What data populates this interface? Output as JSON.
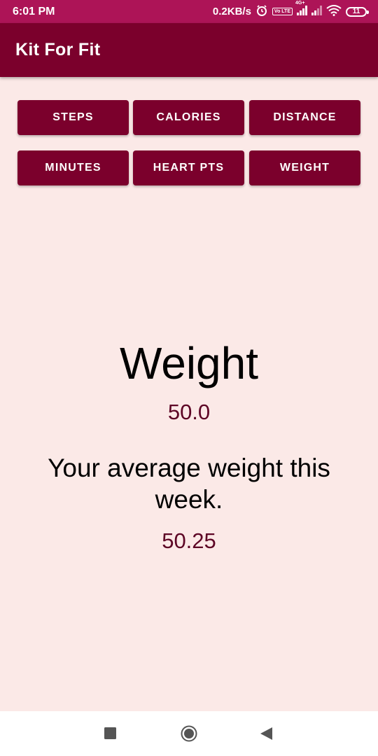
{
  "status_bar": {
    "time": "6:01 PM",
    "net_speed": "0.2KB/s",
    "volte_label": "Vo LTE",
    "network_label": "4G+",
    "battery": "11",
    "icons": [
      "alarm-icon",
      "signal-icon",
      "wifi-icon",
      "battery-icon"
    ]
  },
  "app_bar": {
    "title": "Kit For Fit"
  },
  "buttons": {
    "row1": [
      "STEPS",
      "CALORIES",
      "DISTANCE"
    ],
    "row2": [
      "MINUTES",
      "HEART PTS",
      "WEIGHT"
    ]
  },
  "metric": {
    "title": "Weight",
    "value": "50.0",
    "average_label": "Your average weight this week.",
    "average_value": "50.25"
  },
  "nav_bar": {
    "icons": [
      "recents-icon",
      "home-icon",
      "back-icon"
    ]
  },
  "colors": {
    "status_bar": "#ad1457",
    "primary": "#7b002c",
    "background": "#fbe9e7",
    "value_text": "#5d0525"
  }
}
